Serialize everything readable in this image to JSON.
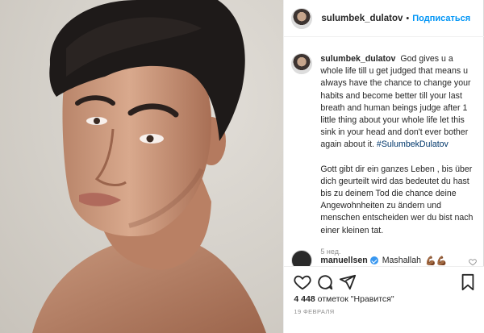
{
  "header": {
    "username": "sulumbek_dulatov",
    "separator": "•",
    "follow_label": "Подписаться"
  },
  "caption": {
    "username": "sulumbek_dulatov",
    "text": "God gives u a whole life till u get judged that means u always have the chance to change your habits and become better till your last breath and human beings judge after 1 little thing about your whole life let this sink in your head and don't ever bother again about it.",
    "hashtag": "#SulumbekDulatov",
    "text_german": "Gott gibt dir ein ganzes Leben , bis über dich geurteilt wird das bedeutet du hast bis zu deinem Tod die chance deine Angewohnheiten zu ändern und menschen entscheiden wer du bist nach einer kleinen tat.",
    "time": "5 нед."
  },
  "comment": {
    "username": "manuellsen",
    "text": "Mashallah",
    "emoji": "💪🏾💪🏾"
  },
  "actions": {
    "icons": [
      "heart-icon",
      "comment-icon",
      "share-icon",
      "bookmark-icon"
    ],
    "views_count": "4 448",
    "views_label": "отметок \"Нравится\"",
    "date": "19 февраля"
  },
  "colors": {
    "accent": "#0095f6",
    "hashtag": "#00376b",
    "muted": "#8e8e8e",
    "verified": "#3897f0"
  }
}
